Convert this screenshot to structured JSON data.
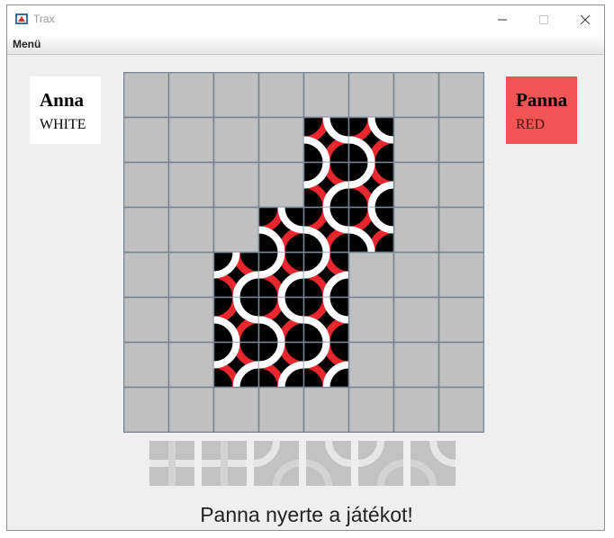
{
  "window": {
    "title": "Trax"
  },
  "menu": {
    "label": "Menü"
  },
  "players": [
    {
      "name": "Anna",
      "color": "WHITE"
    },
    {
      "name": "Panna",
      "color": "RED",
      "highlight": "#f05454"
    }
  ],
  "board": {
    "rows": 8,
    "cols": 8,
    "empty_color": "#c0c0c0",
    "grid_color": "#7a8490",
    "placed_tiles": [
      {
        "row": 1,
        "col": 4,
        "type": "A"
      },
      {
        "row": 1,
        "col": 5,
        "type": "A"
      },
      {
        "row": 2,
        "col": 4,
        "type": "B"
      },
      {
        "row": 2,
        "col": 5,
        "type": "B"
      },
      {
        "row": 3,
        "col": 3,
        "type": "A"
      },
      {
        "row": 3,
        "col": 4,
        "type": "A"
      },
      {
        "row": 3,
        "col": 5,
        "type": "A"
      },
      {
        "row": 4,
        "col": 2,
        "type": "B"
      },
      {
        "row": 4,
        "col": 3,
        "type": "B"
      },
      {
        "row": 4,
        "col": 4,
        "type": "B"
      },
      {
        "row": 5,
        "col": 2,
        "type": "A"
      },
      {
        "row": 5,
        "col": 3,
        "type": "A"
      },
      {
        "row": 5,
        "col": 4,
        "type": "A"
      },
      {
        "row": 6,
        "col": 2,
        "type": "B"
      },
      {
        "row": 6,
        "col": 3,
        "type": "B"
      },
      {
        "row": 6,
        "col": 4,
        "type": "B"
      }
    ]
  },
  "tile_palette": [
    "straight",
    "straight",
    "curve",
    "curve",
    "curve",
    "curve"
  ],
  "colors": {
    "red": "#e8262e",
    "white": "#ffffff",
    "tile_bg": "#000000"
  },
  "status": "Panna nyerte a játékot!"
}
